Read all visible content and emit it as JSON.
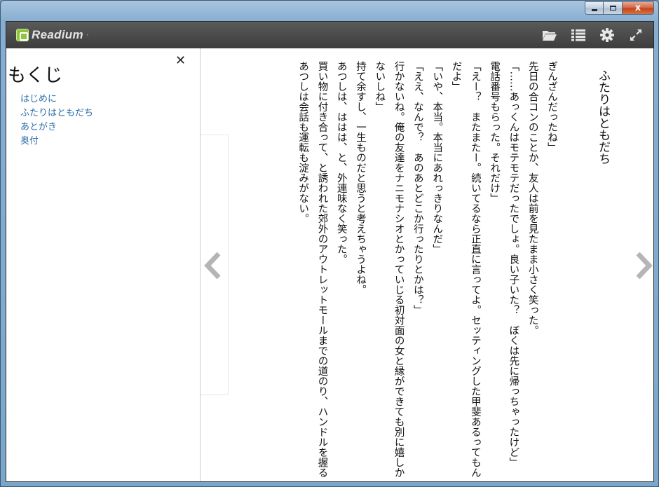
{
  "window": {
    "minimize_label": "",
    "maximize_label": "",
    "close_label": "x"
  },
  "toolbar": {
    "app_name": "Readium",
    "icons": [
      "folder-open-icon",
      "list-icon",
      "gear-icon",
      "fullscreen-icon"
    ]
  },
  "toc": {
    "title": "もくじ",
    "items": [
      "はじめに",
      "ふたりはともだち",
      "あとがき",
      "奥付"
    ]
  },
  "book": {
    "chapter_title": "ふたりはともだち",
    "lines": [
      "ぎんざんだったね」",
      "先日の合コンのことか、友人は前を見たまま小さく笑った。",
      "「……あっくんはモテモテだったでしょ。良い子いた？　ぼくは先に帰っちゃったけど」",
      "電話番号もらった。それだけ」",
      "「えー？　またまたー。続いてるなら正直に言ってよ。セッティングした甲斐あるってもんだよ」",
      "「いや、本当。本当にあれっきりなんだ」",
      "「ええ、なんで？　あのあとどこか行ったりとかは？」",
      "行かないね。俺の友達をナニモナシオとかっていじる初対面の女と縁ができても別に嬉しかないしね」",
      "持て余すし、一生ものだと思うと考えちゃうよね。",
      "あつしは、ははは、と、外連味なく笑った。",
      "買い物に付き合って、と誘われた郊外のアウトレットモールまでの道のり、ハンドルを握るあつしは会話も運転も淀みがない。"
    ]
  },
  "colors": {
    "toolbar_bg": "#474747",
    "link": "#2a6ea8",
    "brand_green": "#8fc43c"
  }
}
